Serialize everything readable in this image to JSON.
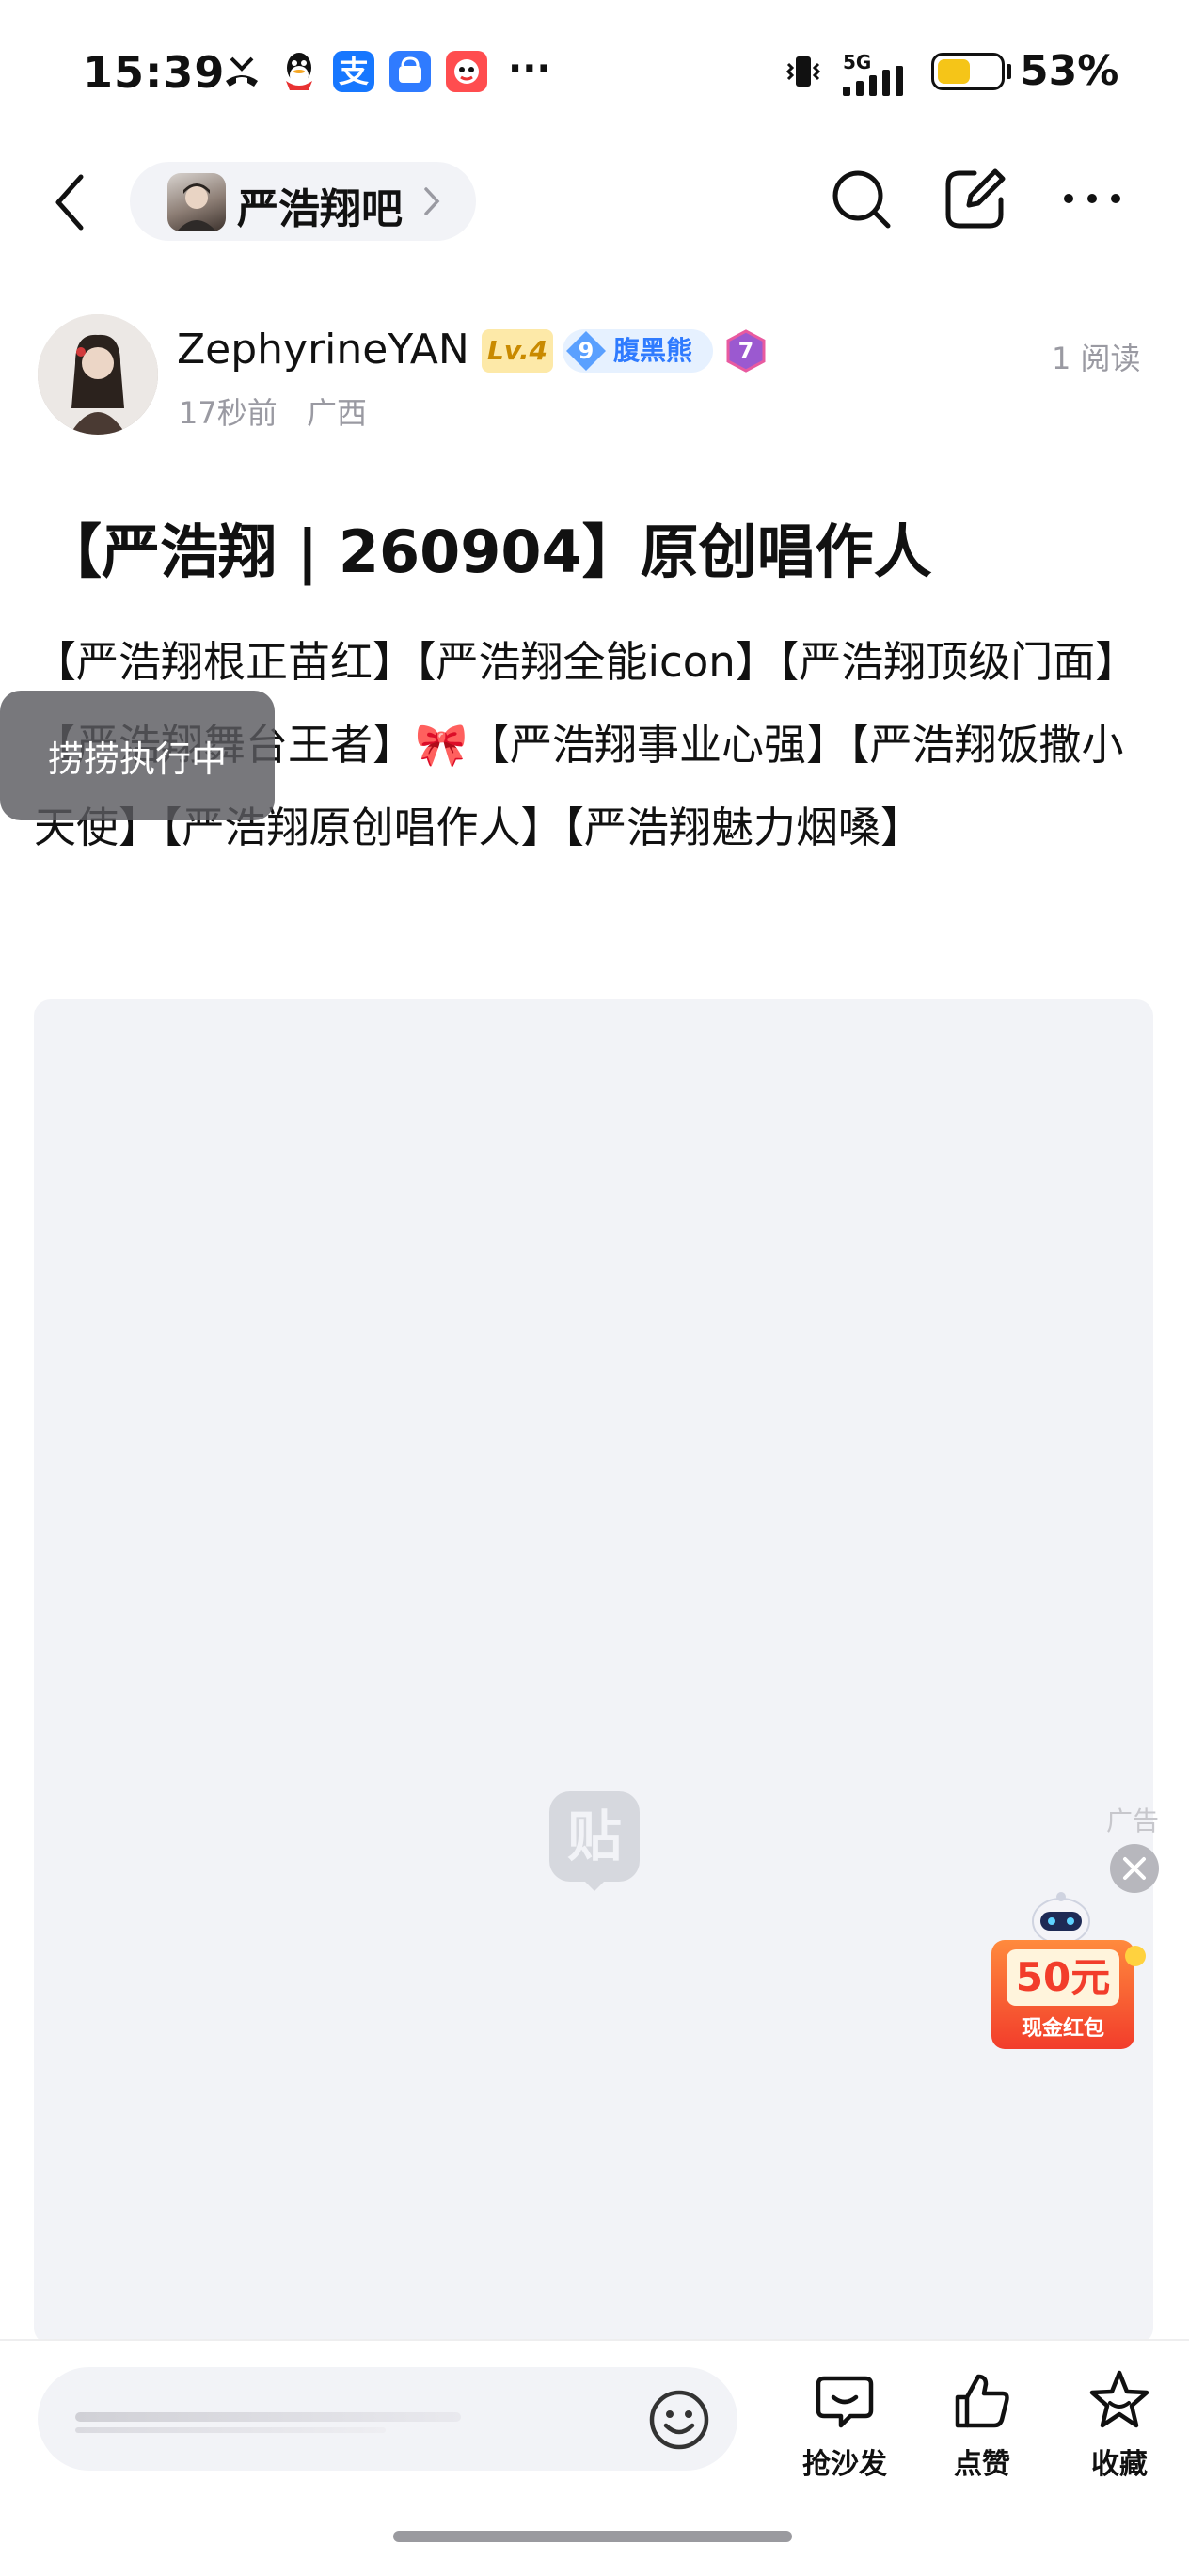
{
  "status_bar": {
    "time": "15:39",
    "more": "···",
    "network": "5G",
    "battery_percent": "53%",
    "battery_level": 0.53,
    "app_icons": [
      "missed-call-icon",
      "qq-icon",
      "alipay-icon",
      "app-market-icon",
      "game-app-icon"
    ]
  },
  "nav": {
    "forum_name": "严浩翔吧",
    "actions": [
      "back-icon",
      "search-icon",
      "edit-icon",
      "more-icon"
    ]
  },
  "author": {
    "name": "ZephyrineYAN",
    "level_badge": "Lv.4",
    "fan_badge_num": "9",
    "fan_badge_label": "腹黑熊",
    "extra_badge": "7",
    "posted_time": "17秒前",
    "location": "广西",
    "read_count": "1 阅读"
  },
  "post": {
    "title": "【严浩翔 | 260904】原创唱作人",
    "body": "【严浩翔根正苗红】【严浩翔全能icon】【严浩翔顶级门面】【严浩翔舞台王者】🎀【严浩翔事业心强】【严浩翔饭撒小天使】【严浩翔原创唱作人】【严浩翔魅力烟嗓】",
    "toast": "捞捞执行中",
    "placeholder_logo": "贴"
  },
  "ad": {
    "label": "广告",
    "amount": "50元",
    "caption": "现金红包"
  },
  "bottom_bar": {
    "sofa_label": "抢沙发",
    "like_label": "点赞",
    "favorite_label": "收藏"
  }
}
